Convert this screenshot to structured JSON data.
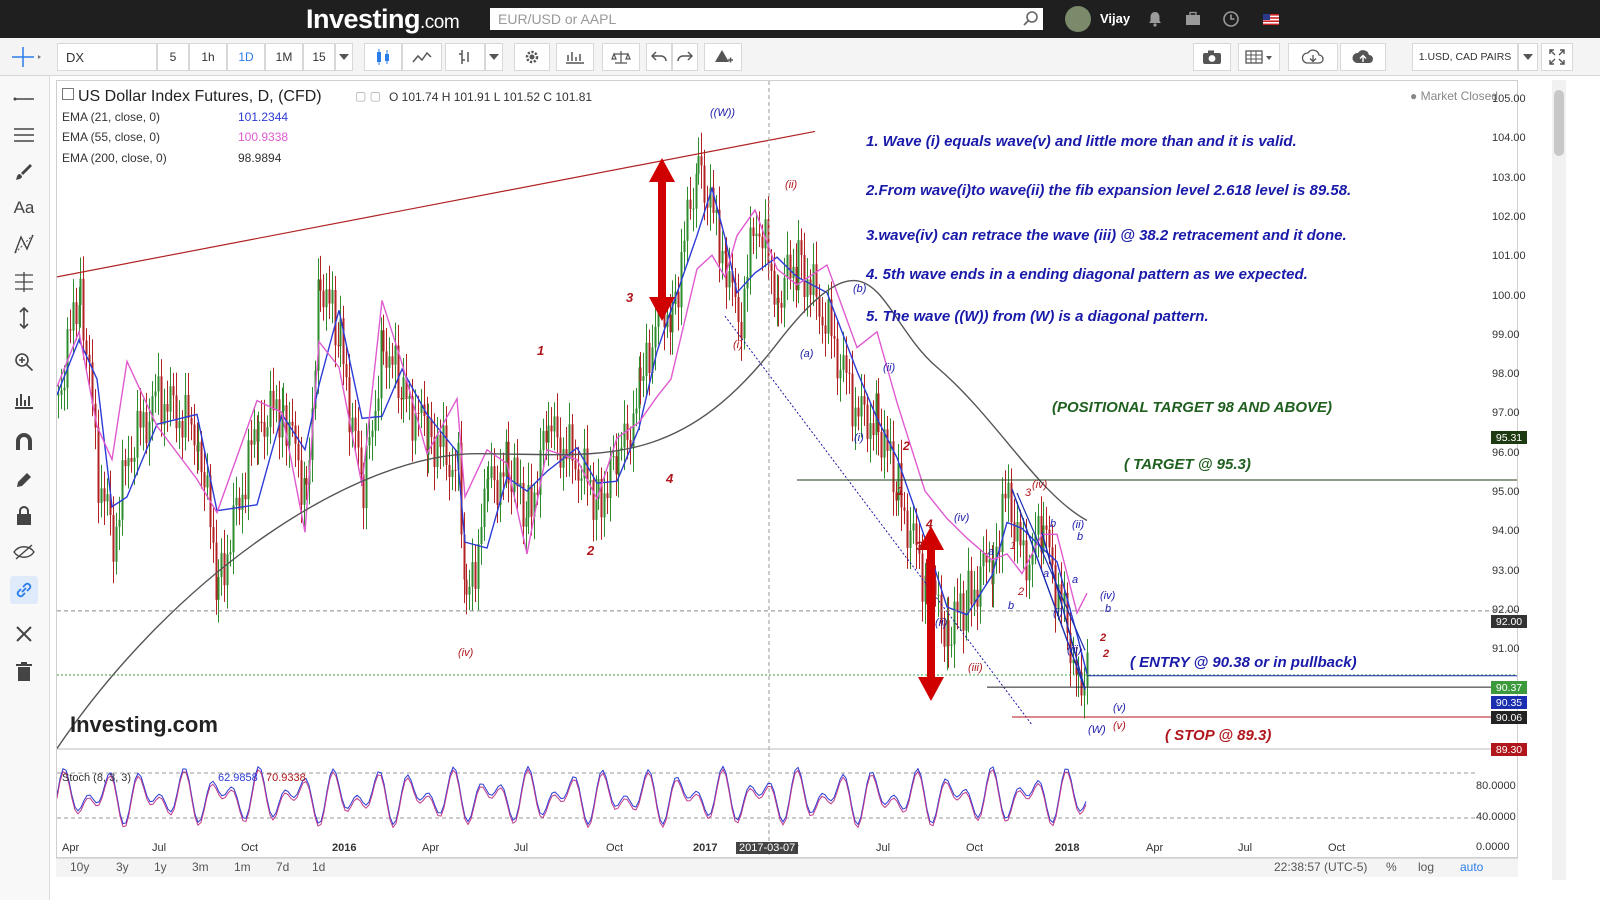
{
  "header": {
    "logo_main": "Investing",
    "logo_suffix": ".com",
    "search_placeholder": "EUR/USD or AAPL",
    "user_name": "Vijay"
  },
  "toolbar": {
    "symbol": "DX",
    "intervals": [
      "5",
      "1h",
      "1D",
      "1M",
      "15"
    ],
    "active_interval": "1D",
    "pair_label": "1.USD, CAD PAIRS"
  },
  "chart": {
    "title": "US Dollar Index Futures, D, (CFD)",
    "ohlc": "O 101.74  H 101.91  L 101.52  C 101.81",
    "market_status": "Market Closed",
    "watermark": "Investing.com",
    "ema21_label": "EMA (21, close, 0)",
    "ema21_value": "101.2344",
    "ema55_label": "EMA (55, close, 0)",
    "ema55_value": "100.9338",
    "ema200_label": "EMA (200, close, 0)",
    "ema200_value": "98.9894",
    "colors": {
      "candle_up": "#2e8b2e",
      "candle_down": "#b22222",
      "ema21": "#2c3bd6",
      "ema55": "#e05ad0",
      "ema200": "#555555",
      "annotation": "#1a1aaa",
      "target": "#1f5f1f",
      "stop": "#b0161c"
    }
  },
  "notes": {
    "n1": "1. Wave (i) equals wave(v) and little more than and it is valid.",
    "n2": "2.From wave(i)to wave(ii) the fib expansion level 2.618 level is 89.58.",
    "n3": "3.wave(iv) can retrace the wave (iii) @ 38.2 retracement and it done.",
    "n4": "4. 5th wave ends in a ending diagonal pattern as we expected.",
    "n5": "5. The wave ((W)) from (W) is a diagonal pattern.",
    "positional": "(POSITIONAL TARGET 98 AND ABOVE)",
    "target": "( TARGET @ 95.3)",
    "entry": "( ENTRY @ 90.38 or in pullback)",
    "stop": "( STOP @ 89.3)"
  },
  "wave_labels": {
    "WW_top": "((W))",
    "ii_a": "(ii)",
    "i_a": "(i)",
    "a_a": "(a)",
    "b_a": "(b)",
    "l1": "1",
    "l2": "2",
    "l3": "3",
    "l4": "4",
    "iv_left": "(iv)",
    "ii_b": "(ii)",
    "i_b": "(i)",
    "r2": "2",
    "r1": "1",
    "r4": "4",
    "r3": "3",
    "iv_b": "(iv)",
    "iii_b": "(iii)",
    "ii_c": "(ii)",
    "iv_c": "(iv)",
    "s3": "3",
    "sa": "a",
    "sb": "b",
    "s1": "1",
    "s2": "2",
    "t_b1": "b",
    "t_ii": "(ii)",
    "t_b2": "b",
    "t_a1": "a",
    "t_a2": "a",
    "t_i": "(i)",
    "t_iii": "(iii)",
    "t_iv": "(iv)",
    "t_b3": "b",
    "t_2a": "2",
    "t_2b": "2",
    "t_v1": "(v)",
    "t_W": "(W)",
    "t_v2": "(v)"
  },
  "price_axis": [
    "105.00",
    "104.00",
    "103.00",
    "102.00",
    "101.00",
    "100.00",
    "99.00",
    "98.00",
    "97.00",
    "96.00",
    "95.00",
    "94.00",
    "93.00",
    "92.00",
    "91.00",
    "90.00"
  ],
  "price_boxes": {
    "b9531": "95.31",
    "b9200": "92.00",
    "b9037": "90.37",
    "b9035": "90.35",
    "b9006": "90.06",
    "b8930": "89.30"
  },
  "stoch": {
    "label": "Stoch (8, 3, 3)",
    "k_value": "62.9858",
    "d_value": "70.9338",
    "axis": [
      "80.0000",
      "40.0000",
      "0.0000"
    ]
  },
  "time_axis": [
    "Apr",
    "Jul",
    "Oct",
    "2016",
    "Apr",
    "Jul",
    "Oct",
    "2017",
    "2017-03-07",
    "r",
    "Jul",
    "Oct",
    "2018",
    "Apr",
    "Jul",
    "Oct"
  ],
  "bottom": {
    "ranges": [
      "10y",
      "3y",
      "1y",
      "3m",
      "1m",
      "7d",
      "1d"
    ],
    "clock": "22:38:57 (UTC-5)",
    "pct": "%",
    "log": "log",
    "auto": "auto"
  }
}
